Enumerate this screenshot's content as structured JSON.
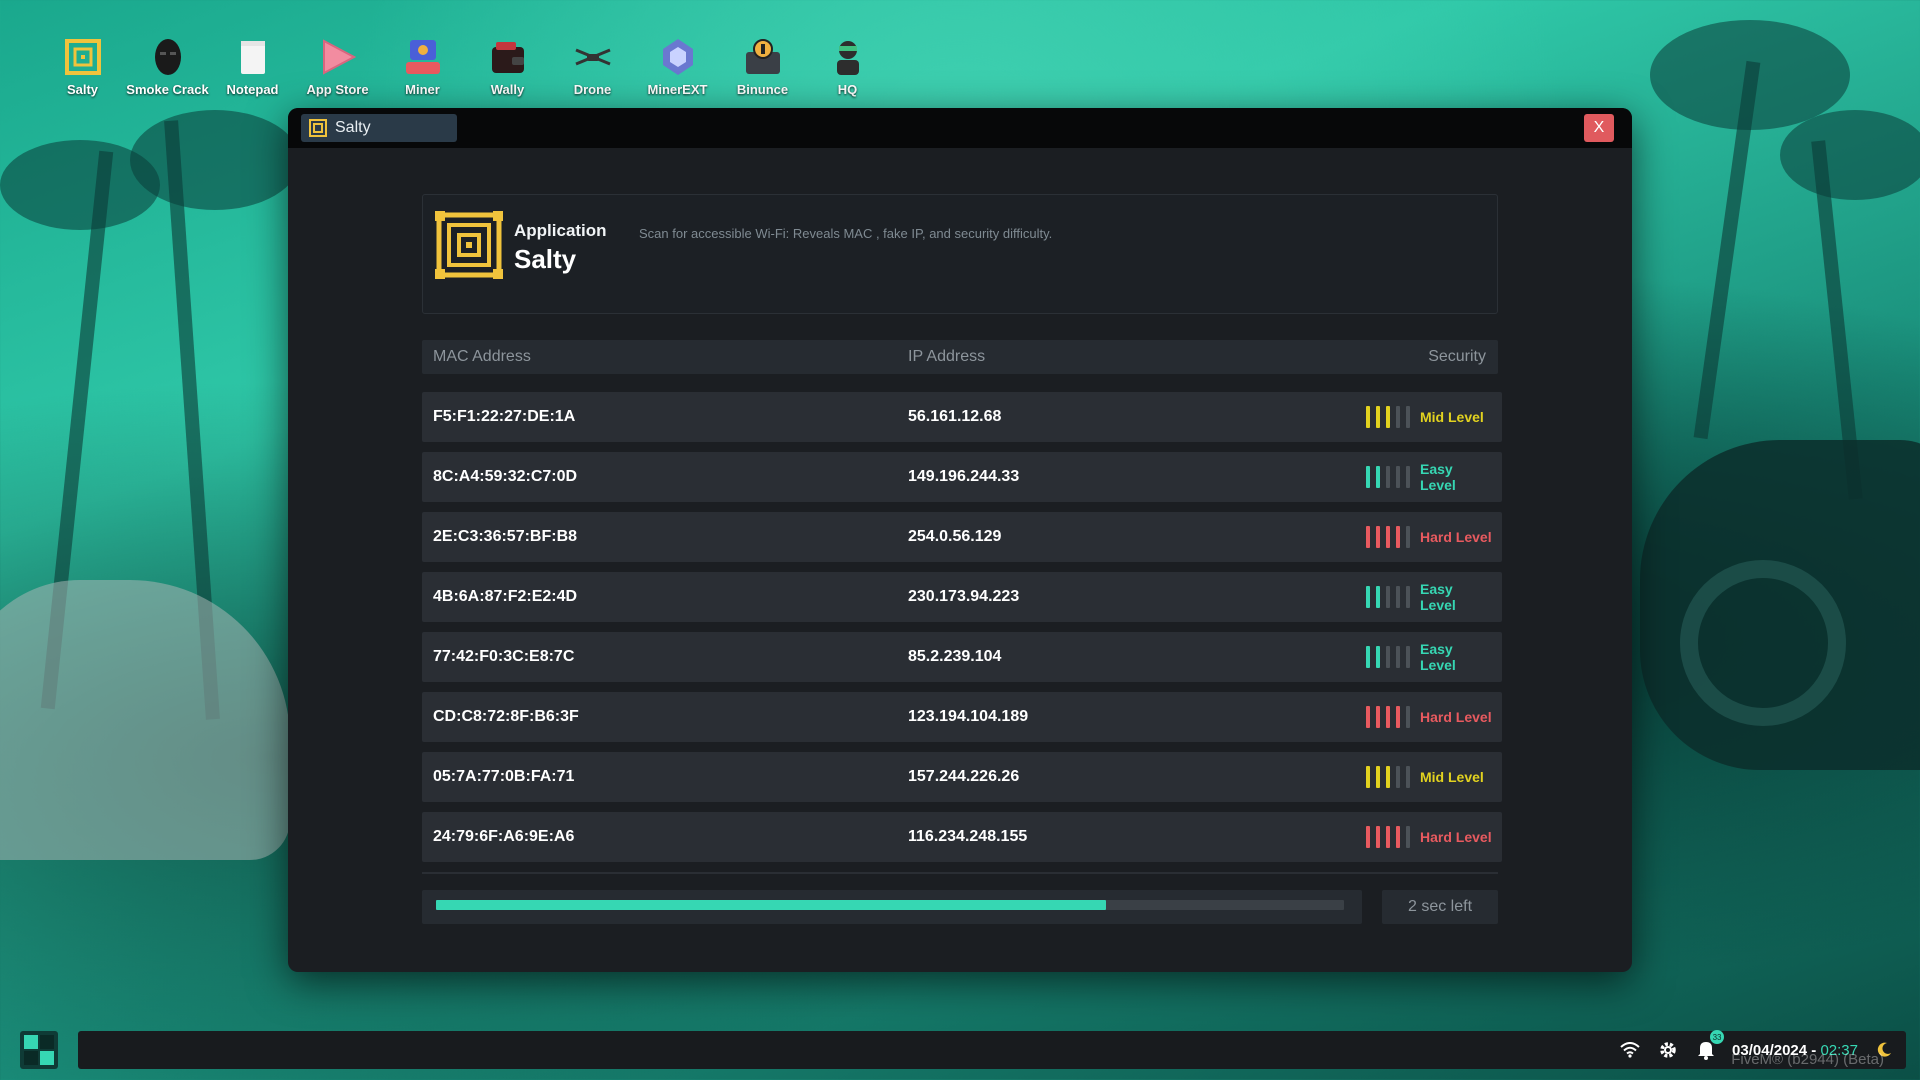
{
  "desktop": {
    "icons": [
      {
        "label": "Salty",
        "icon": "salty-maze-icon"
      },
      {
        "label": "Smoke Crack",
        "icon": "mask-icon"
      },
      {
        "label": "Notepad",
        "icon": "notepad-icon"
      },
      {
        "label": "App Store",
        "icon": "play-store-icon"
      },
      {
        "label": "Miner",
        "icon": "miner-icon"
      },
      {
        "label": "Wally",
        "icon": "wallet-icon"
      },
      {
        "label": "Drone",
        "icon": "drone-icon"
      },
      {
        "label": "MinerEXT",
        "icon": "miner-ext-icon"
      },
      {
        "label": "Binunce",
        "icon": "bitcoin-wallet-icon"
      },
      {
        "label": "HQ",
        "icon": "hacker-icon"
      }
    ]
  },
  "window": {
    "title": "Salty",
    "close_label": "X"
  },
  "app": {
    "category": "Application",
    "name": "Salty",
    "description": "Scan for accessible Wi-Fi: Reveals MAC , fake IP, and security difficulty."
  },
  "table": {
    "headers": {
      "mac": "MAC Address",
      "ip": "IP Address",
      "security": "Security"
    },
    "rows": [
      {
        "mac": "F5:F1:22:27:DE:1A",
        "ip": "56.161.12.68",
        "level": "Mid Level",
        "bars": 3,
        "color": "#e2d21f"
      },
      {
        "mac": "8C:A4:59:32:C7:0D",
        "ip": "149.196.244.33",
        "level": "Easy Level",
        "bars": 2,
        "color": "#36d7b3"
      },
      {
        "mac": "2E:C3:36:57:BF:B8",
        "ip": "254.0.56.129",
        "level": "Hard Level",
        "bars": 4,
        "color": "#e85a5f"
      },
      {
        "mac": "4B:6A:87:F2:E2:4D",
        "ip": "230.173.94.223",
        "level": "Easy Level",
        "bars": 2,
        "color": "#36d7b3"
      },
      {
        "mac": "77:42:F0:3C:E8:7C",
        "ip": "85.2.239.104",
        "level": "Easy Level",
        "bars": 2,
        "color": "#36d7b3"
      },
      {
        "mac": "CD:C8:72:8F:B6:3F",
        "ip": "123.194.104.189",
        "level": "Hard Level",
        "bars": 4,
        "color": "#e85a5f"
      },
      {
        "mac": "05:7A:77:0B:FA:71",
        "ip": "157.244.226.26",
        "level": "Mid Level",
        "bars": 3,
        "color": "#e2d21f"
      },
      {
        "mac": "24:79:6F:A6:9E:A6",
        "ip": "116.234.248.155",
        "level": "Hard Level",
        "bars": 4,
        "color": "#e85a5f"
      }
    ],
    "max_bars": 5
  },
  "scan": {
    "progress_fraction": 0.738,
    "timer_label": "2 sec left"
  },
  "taskbar": {
    "notification_count": "33",
    "date": "03/04/2024",
    "separator": " - ",
    "time": "02:37",
    "watermark": "FiveM® (b2944) (Beta)"
  },
  "colors": {
    "accent": "#36d7b3",
    "mid": "#e2d21f",
    "hard": "#e85a5f",
    "close": "#e05a5e"
  }
}
